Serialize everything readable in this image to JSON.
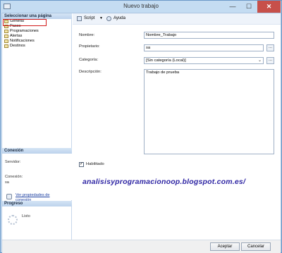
{
  "window": {
    "title": "Nuevo trabajo"
  },
  "sidebar": {
    "header": "Seleccionar una página",
    "items": [
      {
        "label": "General"
      },
      {
        "label": "Pasos"
      },
      {
        "label": "Programaciones"
      },
      {
        "label": "Alertas"
      },
      {
        "label": "Notificaciones"
      },
      {
        "label": "Destinos"
      }
    ],
    "connection_header": "Conexión",
    "server_label": "Servidor:",
    "connection_label": "Conexión:",
    "connection_value": "sa",
    "view_props_link": "Ver propiedades de conexión",
    "progress_header": "Progreso",
    "progress_status": "Listo"
  },
  "toolbar": {
    "script_label": "Script",
    "help_label": "Ayuda"
  },
  "form": {
    "name_label": "Nombre:",
    "name_value": "Nombre_Trabajo",
    "owner_label": "Propietario:",
    "owner_value": "sa",
    "category_label": "Categoría:",
    "category_value": "[Sin categoría (Local)]",
    "description_label": "Descripción:",
    "description_value": "Trabajo de prueba",
    "enabled_label": "Habilitado",
    "enabled": true,
    "ellipsis": "..."
  },
  "watermark": "analisisyprogramacionoop.blogspot.com.es/",
  "buttons": {
    "ok": "Aceptar",
    "cancel": "Cancelar"
  }
}
